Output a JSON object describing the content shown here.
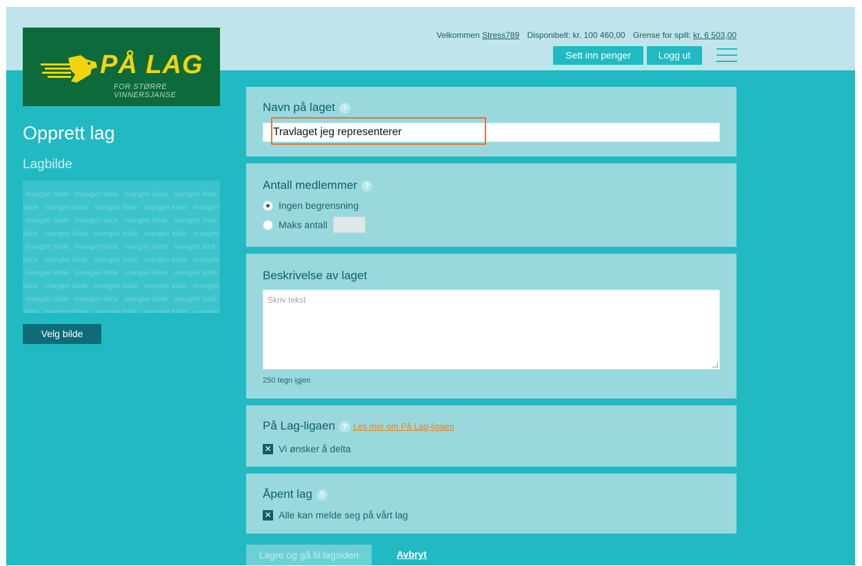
{
  "brand": {
    "title": "PÅ LAG",
    "subtitle": "FOR STØRRE VINNERSJANSE",
    "colors": {
      "green": "#0c6a3b",
      "yellow": "#f3d40b",
      "teal": "#21b9c2",
      "dark_teal": "#0e6c78",
      "orange": "#e27435"
    }
  },
  "header": {
    "welcome_label": "Velkommen",
    "username": "Stress789",
    "available_label": "Disponibelt: kr. 100 460,00",
    "limit_label": "Grense for spill:",
    "limit_value": "kr. 6 503,00",
    "deposit_button": "Sett inn penger",
    "logout_button": "Logg ut",
    "menu_icon": "hamburger-icon"
  },
  "left": {
    "page_title": "Opprett lag",
    "image_heading": "Lagbilde",
    "placeholder_word": "mangler bilde",
    "choose_image_button": "Velg bilde"
  },
  "form": {
    "name": {
      "label": "Navn på laget",
      "help_icon": "question-icon",
      "value": "Travlaget jeg representerer"
    },
    "members": {
      "label": "Antall medlemmer",
      "help_icon": "question-icon",
      "option_unlimited": "Ingen begrensning",
      "option_max": "Maks antall",
      "selected": "unlimited"
    },
    "description": {
      "label": "Beskrivelse av laget",
      "placeholder": "Skriv tekst",
      "chars_left": "250 tegn igjen"
    },
    "league": {
      "label": "På Lag-ligaen",
      "help_icon": "question-icon",
      "link": "Les mer om På Lag-ligaen",
      "checkbox_label": "Vi ønsker å delta",
      "checked": true
    },
    "open": {
      "label": "Åpent lag",
      "help_icon": "question-icon",
      "checkbox_label": "Alle kan melde seg på vårt lag",
      "checked": true
    }
  },
  "actions": {
    "save_button": "Lagre og gå til lagsiden",
    "cancel_link": "Avbryt"
  }
}
